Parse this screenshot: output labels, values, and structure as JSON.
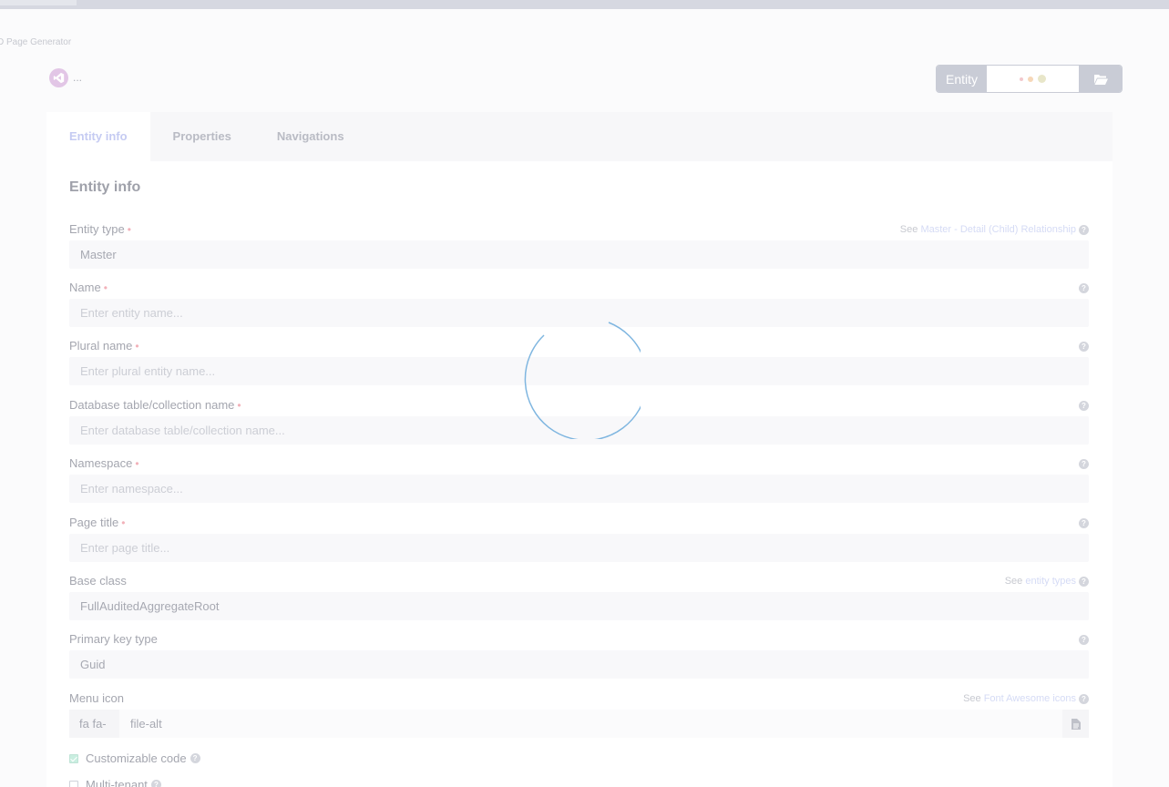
{
  "app": {
    "title": "JD Page Generator",
    "logo_extra": "..."
  },
  "toolbar": {
    "entity_label": "Entity",
    "entity_dots": [
      "#f2c8cc",
      "#f6d7b8",
      "#e8e6c9"
    ],
    "folder_icon": "folder-open-icon"
  },
  "tabs": [
    {
      "label": "Entity info",
      "active": true
    },
    {
      "label": "Properties",
      "active": false
    },
    {
      "label": "Navigations",
      "active": false
    }
  ],
  "section": {
    "title": "Entity info"
  },
  "fields": {
    "entity_type": {
      "label": "Entity type",
      "required": true,
      "value": "Master",
      "see_prefix": "See",
      "see_link": "Master - Detail (Child) Relationship"
    },
    "name": {
      "label": "Name",
      "required": true,
      "placeholder": "Enter entity name..."
    },
    "plural_name": {
      "label": "Plural name",
      "required": true,
      "placeholder": "Enter plural entity name..."
    },
    "db_table": {
      "label": "Database table/collection name",
      "required": true,
      "placeholder": "Enter database table/collection name..."
    },
    "namespace": {
      "label": "Namespace",
      "required": true,
      "placeholder": "Enter namespace..."
    },
    "page_title": {
      "label": "Page title",
      "required": true,
      "placeholder": "Enter page title..."
    },
    "base_class": {
      "label": "Base class",
      "value": "FullAuditedAggregateRoot",
      "see_prefix": "See",
      "see_link": "entity types"
    },
    "primary_key": {
      "label": "Primary key type",
      "value": "Guid"
    },
    "menu_icon": {
      "label": "Menu icon",
      "prefix": "fa fa-",
      "value": "file-alt",
      "see_prefix": "See",
      "see_link": "Font Awesome icons"
    }
  },
  "required_marker": "•",
  "help_glyph": "?",
  "checkboxes": [
    {
      "label": "Customizable code",
      "checked": true
    },
    {
      "label": "Multi-tenant",
      "checked": false
    }
  ],
  "colors": {
    "accent": "#c5cbf2",
    "spinner": "#7fb6e0",
    "required": "#f2b1b9"
  }
}
